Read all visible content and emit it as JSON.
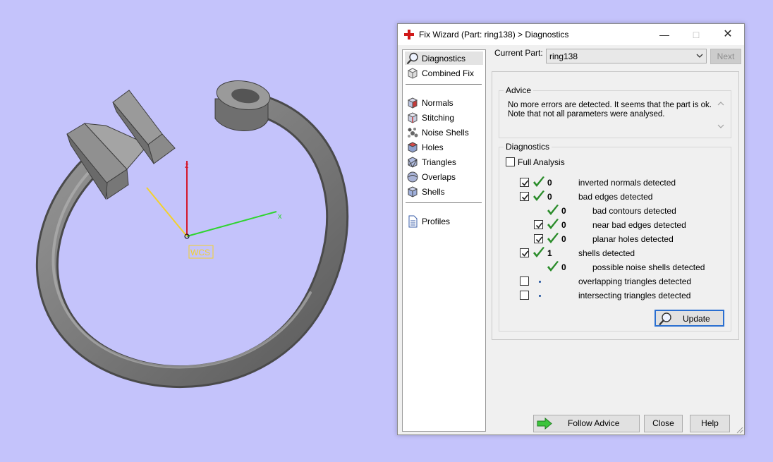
{
  "viewport": {
    "axis_z_label": "z",
    "axis_x_label": "x",
    "wcs_label": "WCS",
    "axis_colors": {
      "x": "#2fd42f",
      "y": "#f3d12b",
      "z": "#d4182a"
    },
    "model_color": "#8a8a8a"
  },
  "dialog": {
    "title": "Fix Wizard (Part: ring138) > Diagnostics",
    "window_buttons": {
      "minimize": "—",
      "maximize": "□",
      "close": "✕"
    }
  },
  "nav": {
    "items": [
      {
        "label": "Diagnostics",
        "icon": "magnifier-icon"
      },
      {
        "label": "Combined Fix",
        "icon": "cube-icon"
      },
      {
        "label": "Normals",
        "icon": "normals-cube-icon"
      },
      {
        "label": "Stitching",
        "icon": "stitching-cube-icon"
      },
      {
        "label": "Noise Shells",
        "icon": "noise-shells-icon"
      },
      {
        "label": "Holes",
        "icon": "holes-cube-icon"
      },
      {
        "label": "Triangles",
        "icon": "triangles-cube-icon"
      },
      {
        "label": "Overlaps",
        "icon": "overlaps-icon"
      },
      {
        "label": "Shells",
        "icon": "shells-cube-icon"
      },
      {
        "label": "Profiles",
        "icon": "document-icon"
      }
    ]
  },
  "current_part": {
    "label": "Current Part:",
    "value": "ring138",
    "next_label": "Next"
  },
  "advice": {
    "title": "Advice",
    "text": "No more errors are detected. It seems that the part is ok. Note that not all parameters were analysed."
  },
  "diagnostics": {
    "title": "Diagnostics",
    "full_analysis_label": "Full Analysis",
    "full_analysis_checked": false,
    "rows": [
      {
        "label": "inverted normals detected",
        "count": "0",
        "checked": true,
        "status": "ok"
      },
      {
        "label": "bad edges detected",
        "count": "0",
        "checked": true,
        "status": "ok"
      },
      {
        "label": "bad contours detected",
        "count": "0",
        "status": "ok"
      },
      {
        "label": "near bad edges detected",
        "count": "0",
        "checked": true,
        "status": "ok"
      },
      {
        "label": "planar holes detected",
        "count": "0",
        "checked": true,
        "status": "ok"
      },
      {
        "label": "shells detected",
        "count": "1",
        "checked": true,
        "status": "ok"
      },
      {
        "label": "possible noise shells detected",
        "count": "0",
        "status": "ok"
      },
      {
        "label": "overlapping triangles detected",
        "checked": false,
        "status": "not-analysed"
      },
      {
        "label": "intersecting triangles detected",
        "checked": false,
        "status": "not-analysed"
      }
    ],
    "update_label": "Update"
  },
  "buttons": {
    "follow_advice": "Follow Advice",
    "close": "Close",
    "help": "Help"
  },
  "colors": {
    "ok_check": "#2a8c2a",
    "focus_border": "#2a6fd1",
    "arrow_green": "#3cc43c"
  }
}
